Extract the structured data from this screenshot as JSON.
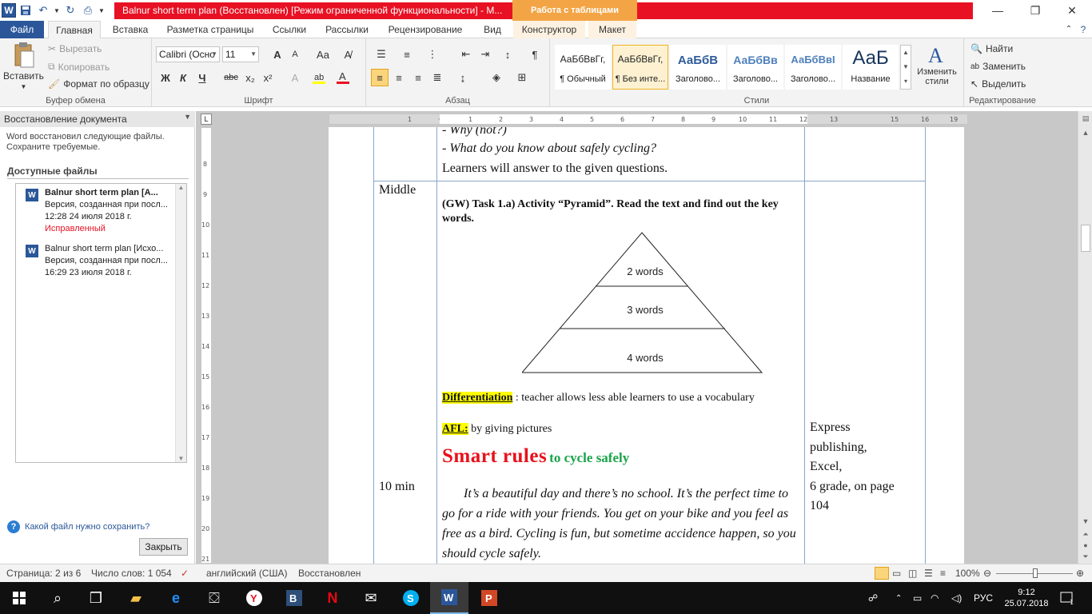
{
  "window": {
    "title": "Balnur short term plan (Восстановлен) [Режим ограниченной функциональности] - M...",
    "contextual_tab_header": "Работа с таблицами"
  },
  "tabs": [
    "Файл",
    "Главная",
    "Вставка",
    "Разметка страницы",
    "Ссылки",
    "Рассылки",
    "Рецензирование",
    "Вид",
    "Конструктор",
    "Макет"
  ],
  "ribbon": {
    "clipboard": {
      "paste": "Вставить",
      "cut": "Вырезать",
      "copy": "Копировать",
      "format_painter": "Формат по образцу",
      "label": "Буфер обмена"
    },
    "font": {
      "name": "Calibri (Осно",
      "size": "11",
      "label": "Шрифт",
      "bold": "Ж",
      "italic": "К",
      "underline": "Ч",
      "strike": "abc",
      "case": "Aa",
      "grow": "A",
      "shrink": "A",
      "sub": "x₂",
      "sup": "x²"
    },
    "paragraph": {
      "label": "Абзац"
    },
    "styles": {
      "label": "Стили",
      "items": [
        {
          "sample": "АаБбВвГг,",
          "name": "¶ Обычный"
        },
        {
          "sample": "АаБбВвГг,",
          "name": "¶ Без инте..."
        },
        {
          "sample": "АаБбВ",
          "name": "Заголово..."
        },
        {
          "sample": "АаБбВв",
          "name": "Заголово..."
        },
        {
          "sample": "АаБбВвI",
          "name": "Заголово..."
        },
        {
          "sample": "АаБ",
          "name": "Название"
        }
      ],
      "change_styles": "Изменить стили"
    },
    "editing": {
      "find": "Найти",
      "replace": "Заменить",
      "select": "Выделить",
      "label": "Редактирование"
    }
  },
  "recovery_pane": {
    "title": "Восстановление документа",
    "description": "Word восстановил следующие файлы. Сохраните требуемые.",
    "available": "Доступные файлы",
    "files": [
      {
        "name": "Balnur short term plan  [A...",
        "version": "Версия, созданная при посл...",
        "time": "12:28 24 июля 2018 г.",
        "status": "Исправленный"
      },
      {
        "name": "Balnur short term plan  [Исхо...",
        "version": "Версия, созданная при посл...",
        "time": "16:29 23 июля 2018 г.",
        "status": ""
      }
    ],
    "help": "Какой файл нужно сохранить?",
    "close": "Закрыть"
  },
  "document": {
    "prev_lines": [
      "- Why (not?)",
      "- What do you know about safely cycling?",
      "Learners will answer to the given questions."
    ],
    "stage": "Middle",
    "time": "10 min",
    "task": "(GW) Task 1.a) Activity  “Pyramid”. Read the text and find out the key words.",
    "pyramid": [
      "2 words",
      "3 words",
      "4 words"
    ],
    "differentiation_label": "Differentiation",
    "differentiation_text": " : teacher allows less able learners  to use a vocabulary",
    "afl_label": "AFL:",
    "afl_text": " by giving pictures",
    "smart_rules": "Smart rules",
    "cycle_safely": "to cycle safely",
    "paragraph": "It’s a beautiful day and there’s no school. It’s the perfect time to go for a ride with your friends. You get on your bike and you feel as free as a bird. Cycling is fun, but sometime accidence happen, so you should cycle safely.",
    "resources": [
      "Express",
      "publishing,",
      "Excel,",
      "6 grade, on page",
      "104"
    ]
  },
  "status_bar": {
    "page": "Страница: 2 из 6",
    "words": "Число слов: 1 054",
    "language": "английский (США)",
    "mode": "Восстановлен",
    "zoom": "100%"
  },
  "taskbar": {
    "language": "РУС",
    "time": "9:12",
    "date": "25.07.2018",
    "notifications": "1"
  },
  "colors": {
    "accent": "#2b579a",
    "title_red": "#e81123",
    "contextual": "#f3a546",
    "highlight": "#ffff00",
    "smart_red": "#e8121b",
    "smart_green": "#1aa34a"
  }
}
